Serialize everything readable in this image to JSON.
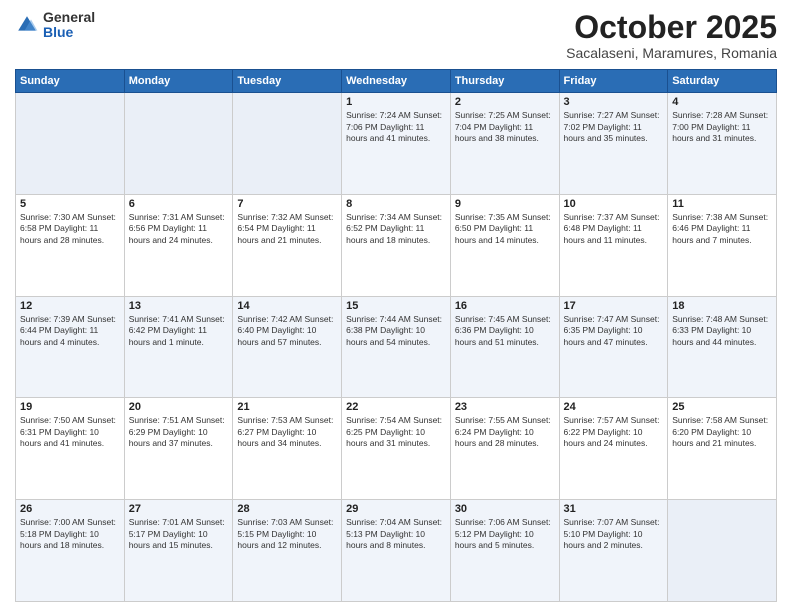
{
  "header": {
    "logo": {
      "general": "General",
      "blue": "Blue"
    },
    "title": "October 2025",
    "location": "Sacalaseni, Maramures, Romania"
  },
  "calendar": {
    "weekdays": [
      "Sunday",
      "Monday",
      "Tuesday",
      "Wednesday",
      "Thursday",
      "Friday",
      "Saturday"
    ],
    "weeks": [
      [
        {
          "day": "",
          "info": ""
        },
        {
          "day": "",
          "info": ""
        },
        {
          "day": "",
          "info": ""
        },
        {
          "day": "1",
          "info": "Sunrise: 7:24 AM\nSunset: 7:06 PM\nDaylight: 11 hours and 41 minutes."
        },
        {
          "day": "2",
          "info": "Sunrise: 7:25 AM\nSunset: 7:04 PM\nDaylight: 11 hours and 38 minutes."
        },
        {
          "day": "3",
          "info": "Sunrise: 7:27 AM\nSunset: 7:02 PM\nDaylight: 11 hours and 35 minutes."
        },
        {
          "day": "4",
          "info": "Sunrise: 7:28 AM\nSunset: 7:00 PM\nDaylight: 11 hours and 31 minutes."
        }
      ],
      [
        {
          "day": "5",
          "info": "Sunrise: 7:30 AM\nSunset: 6:58 PM\nDaylight: 11 hours and 28 minutes."
        },
        {
          "day": "6",
          "info": "Sunrise: 7:31 AM\nSunset: 6:56 PM\nDaylight: 11 hours and 24 minutes."
        },
        {
          "day": "7",
          "info": "Sunrise: 7:32 AM\nSunset: 6:54 PM\nDaylight: 11 hours and 21 minutes."
        },
        {
          "day": "8",
          "info": "Sunrise: 7:34 AM\nSunset: 6:52 PM\nDaylight: 11 hours and 18 minutes."
        },
        {
          "day": "9",
          "info": "Sunrise: 7:35 AM\nSunset: 6:50 PM\nDaylight: 11 hours and 14 minutes."
        },
        {
          "day": "10",
          "info": "Sunrise: 7:37 AM\nSunset: 6:48 PM\nDaylight: 11 hours and 11 minutes."
        },
        {
          "day": "11",
          "info": "Sunrise: 7:38 AM\nSunset: 6:46 PM\nDaylight: 11 hours and 7 minutes."
        }
      ],
      [
        {
          "day": "12",
          "info": "Sunrise: 7:39 AM\nSunset: 6:44 PM\nDaylight: 11 hours and 4 minutes."
        },
        {
          "day": "13",
          "info": "Sunrise: 7:41 AM\nSunset: 6:42 PM\nDaylight: 11 hours and 1 minute."
        },
        {
          "day": "14",
          "info": "Sunrise: 7:42 AM\nSunset: 6:40 PM\nDaylight: 10 hours and 57 minutes."
        },
        {
          "day": "15",
          "info": "Sunrise: 7:44 AM\nSunset: 6:38 PM\nDaylight: 10 hours and 54 minutes."
        },
        {
          "day": "16",
          "info": "Sunrise: 7:45 AM\nSunset: 6:36 PM\nDaylight: 10 hours and 51 minutes."
        },
        {
          "day": "17",
          "info": "Sunrise: 7:47 AM\nSunset: 6:35 PM\nDaylight: 10 hours and 47 minutes."
        },
        {
          "day": "18",
          "info": "Sunrise: 7:48 AM\nSunset: 6:33 PM\nDaylight: 10 hours and 44 minutes."
        }
      ],
      [
        {
          "day": "19",
          "info": "Sunrise: 7:50 AM\nSunset: 6:31 PM\nDaylight: 10 hours and 41 minutes."
        },
        {
          "day": "20",
          "info": "Sunrise: 7:51 AM\nSunset: 6:29 PM\nDaylight: 10 hours and 37 minutes."
        },
        {
          "day": "21",
          "info": "Sunrise: 7:53 AM\nSunset: 6:27 PM\nDaylight: 10 hours and 34 minutes."
        },
        {
          "day": "22",
          "info": "Sunrise: 7:54 AM\nSunset: 6:25 PM\nDaylight: 10 hours and 31 minutes."
        },
        {
          "day": "23",
          "info": "Sunrise: 7:55 AM\nSunset: 6:24 PM\nDaylight: 10 hours and 28 minutes."
        },
        {
          "day": "24",
          "info": "Sunrise: 7:57 AM\nSunset: 6:22 PM\nDaylight: 10 hours and 24 minutes."
        },
        {
          "day": "25",
          "info": "Sunrise: 7:58 AM\nSunset: 6:20 PM\nDaylight: 10 hours and 21 minutes."
        }
      ],
      [
        {
          "day": "26",
          "info": "Sunrise: 7:00 AM\nSunset: 5:18 PM\nDaylight: 10 hours and 18 minutes."
        },
        {
          "day": "27",
          "info": "Sunrise: 7:01 AM\nSunset: 5:17 PM\nDaylight: 10 hours and 15 minutes."
        },
        {
          "day": "28",
          "info": "Sunrise: 7:03 AM\nSunset: 5:15 PM\nDaylight: 10 hours and 12 minutes."
        },
        {
          "day": "29",
          "info": "Sunrise: 7:04 AM\nSunset: 5:13 PM\nDaylight: 10 hours and 8 minutes."
        },
        {
          "day": "30",
          "info": "Sunrise: 7:06 AM\nSunset: 5:12 PM\nDaylight: 10 hours and 5 minutes."
        },
        {
          "day": "31",
          "info": "Sunrise: 7:07 AM\nSunset: 5:10 PM\nDaylight: 10 hours and 2 minutes."
        },
        {
          "day": "",
          "info": ""
        }
      ]
    ]
  }
}
